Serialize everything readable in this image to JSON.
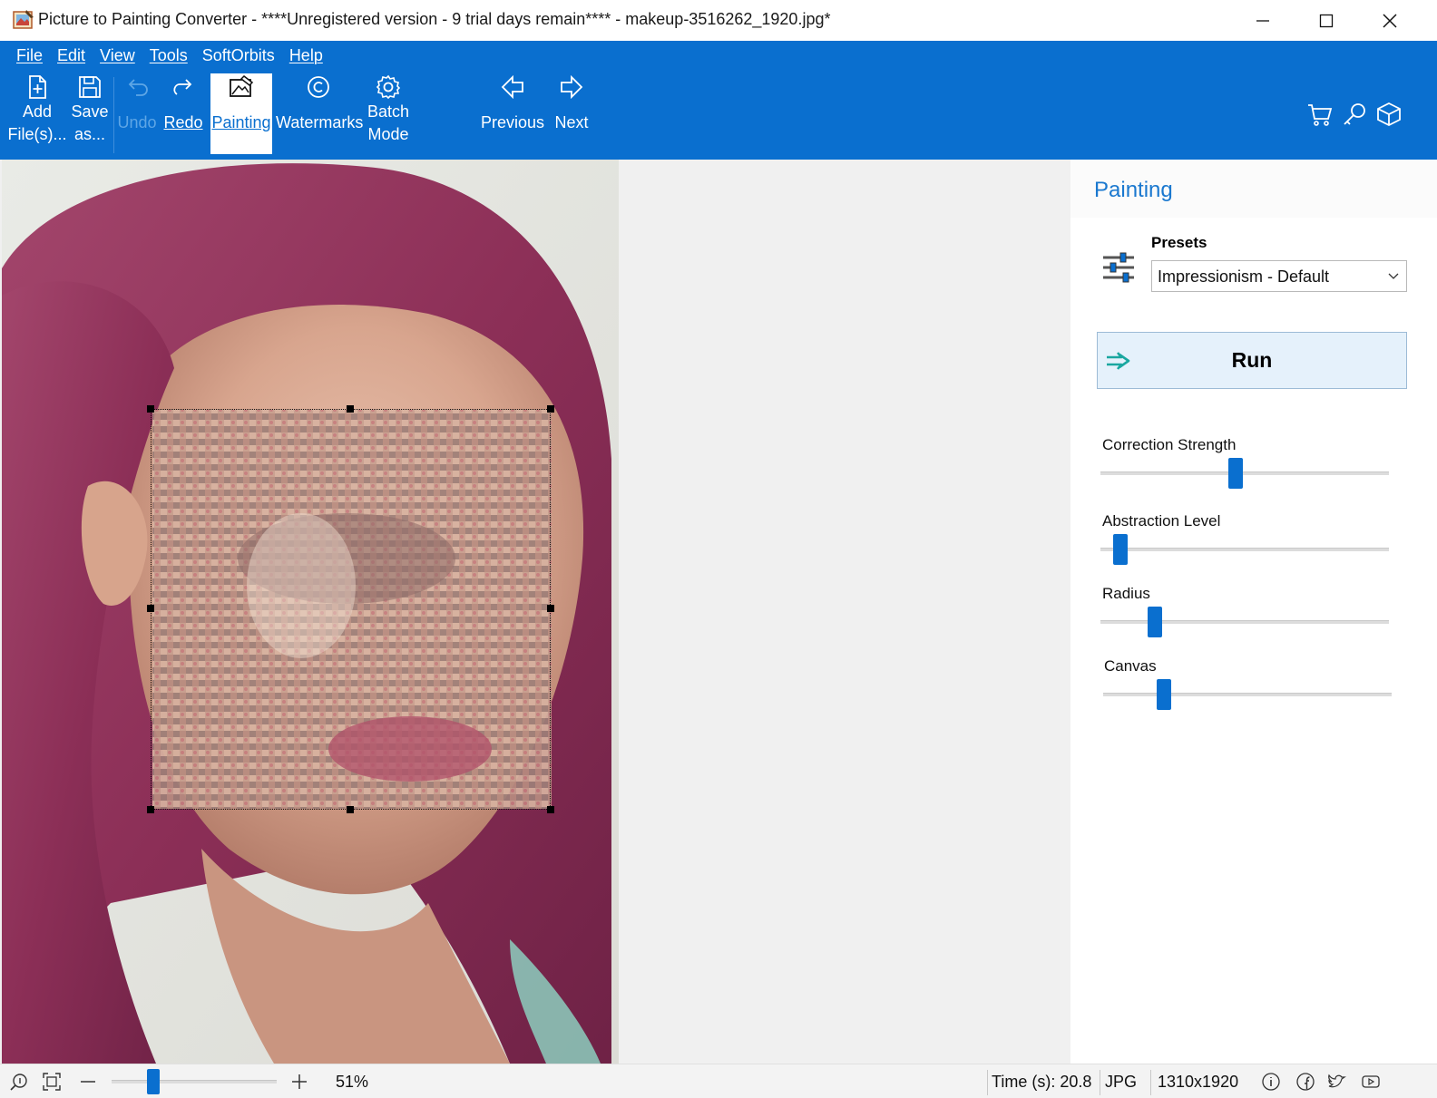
{
  "window": {
    "title": "Picture to Painting Converter - ****Unregistered version - 9 trial days remain**** - makeup-3516262_1920.jpg*",
    "buttons": [
      "minimize",
      "maximize",
      "close"
    ]
  },
  "menu": {
    "items": [
      {
        "label": "File"
      },
      {
        "label": "Edit"
      },
      {
        "label": "View"
      },
      {
        "label": "Tools"
      },
      {
        "label": "SoftOrbits"
      },
      {
        "label": "Help"
      }
    ]
  },
  "toolbar": {
    "add_files": {
      "line1": "Add",
      "line2": "File(s)..."
    },
    "save_as": {
      "line1": "Save",
      "line2": "as..."
    },
    "undo": {
      "label": "Undo"
    },
    "redo": {
      "label": "Redo"
    },
    "painting": {
      "label": "Painting"
    },
    "watermarks": {
      "label": "Watermarks"
    },
    "batch_mode": {
      "line1": "Batch",
      "line2": "Mode"
    },
    "previous": {
      "label": "Previous"
    },
    "next": {
      "label": "Next"
    },
    "right_icons": [
      "cart-icon",
      "key-icon",
      "box-icon"
    ]
  },
  "panel": {
    "title": "Painting",
    "presets": {
      "label": "Presets",
      "selected": "Impressionism - Default"
    },
    "run_label": "Run",
    "sliders": [
      {
        "label": "Correction Strength",
        "value": 0.47
      },
      {
        "label": "Abstraction Level",
        "value": 0.07
      },
      {
        "label": "Radius",
        "value": 0.19
      },
      {
        "label": "Canvas",
        "value": 0.21
      }
    ]
  },
  "status": {
    "zoom": "51%",
    "zoom_fraction": 0.25,
    "time": "Time (s): 20.8",
    "format": "JPG",
    "dimensions": "1310x1920",
    "icons": [
      "info-icon",
      "facebook-icon",
      "twitter-icon",
      "youtube-icon"
    ]
  },
  "colors": {
    "accent": "#0a6fcf",
    "panel_title": "#1a78cf",
    "run_bg": "#e5f1fb"
  }
}
